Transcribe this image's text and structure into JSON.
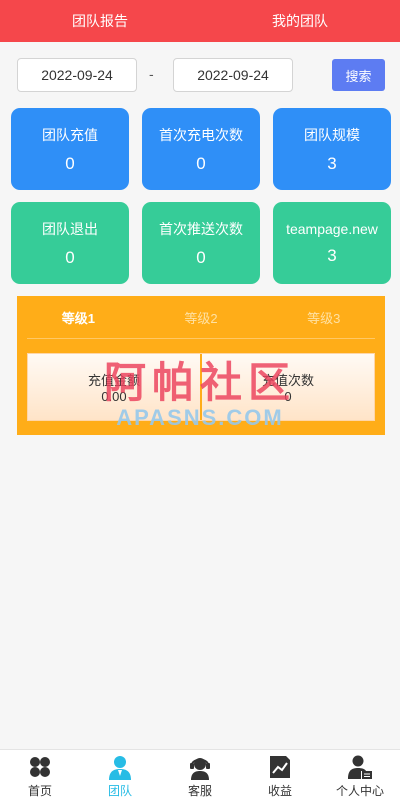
{
  "topnav": {
    "tabs": [
      "团队报告",
      "我的团队"
    ]
  },
  "datebar": {
    "start_date": "2022-09-24",
    "separator": "-",
    "end_date": "2022-09-24",
    "search_label": "搜索"
  },
  "stats": [
    {
      "label": "团队充值",
      "value": "0"
    },
    {
      "label": "首次充电次数",
      "value": "0"
    },
    {
      "label": "团队规模",
      "value": "3"
    },
    {
      "label": "团队退出",
      "value": "0"
    },
    {
      "label": "首次推送次数",
      "value": "0"
    },
    {
      "label": "teampage.new",
      "value": "3"
    }
  ],
  "levels": {
    "tabs": [
      "等级1",
      "等级2",
      "等级3"
    ],
    "active": "等级1",
    "recharge_amount_label": "充值金额",
    "recharge_amount_value": "0.00",
    "recharge_count_label": "充值次数",
    "recharge_count_value": "0"
  },
  "watermark": {
    "cn": "阿帕社区",
    "en": "APASNS.COM"
  },
  "bottomnav": {
    "items": [
      "首页",
      "团队",
      "客服",
      "收益",
      "个人中心"
    ],
    "active": "团队"
  },
  "colors": {
    "header": "#f5474b",
    "card_blue": "#2f8ff7",
    "card_green": "#36cc98",
    "level_panel": "#ffad18",
    "search_button": "#5d7cf2",
    "nav_active": "#27bce5"
  }
}
